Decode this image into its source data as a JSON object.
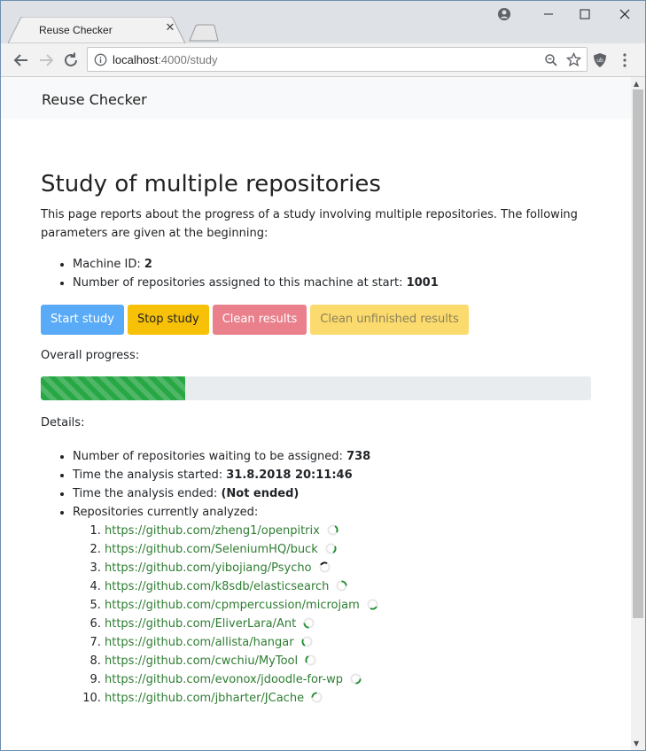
{
  "browser": {
    "tab_title": "Reuse Checker",
    "url_host": "localhost",
    "url_path": ":4000/study"
  },
  "navbar": {
    "brand": "Reuse Checker"
  },
  "page": {
    "title": "Study of multiple repositories",
    "intro": "This page reports about the progress of a study involving multiple repositories. The following parameters are given at the beginning:",
    "params": [
      {
        "label": "Machine ID: ",
        "value": "2"
      },
      {
        "label": "Number of repositories assigned to this machine at start: ",
        "value": "1001"
      }
    ],
    "buttons": {
      "start": "Start study",
      "stop": "Stop study",
      "clean": "Clean results",
      "clean_unfinished": "Clean unfinished results"
    },
    "progress_label": "Overall progress:",
    "progress_fraction": 0.262,
    "details_label": "Details:",
    "details": [
      {
        "label": "Number of repositories waiting to be assigned: ",
        "value": "738"
      },
      {
        "label": "Time the analysis started: ",
        "value": "31.8.2018 20:11:46"
      },
      {
        "label": "Time the analysis ended: ",
        "value": "(Not ended)"
      },
      {
        "label": "Repositories currently analyzed:",
        "value": ""
      }
    ],
    "repos": [
      "https://github.com/zheng1/openpitrix",
      "https://github.com/SeleniumHQ/buck",
      "https://github.com/yibojiang/Psycho",
      "https://github.com/k8sdb/elasticsearch",
      "https://github.com/cpmpercussion/microjam",
      "https://github.com/EliverLara/Ant",
      "https://github.com/allista/hangar",
      "https://github.com/cwchiu/MyTool",
      "https://github.com/evonox/jdoodle-for-wp",
      "https://github.com/jbharter/JCache"
    ]
  },
  "colors": {
    "primary": "#5aabf7",
    "warning": "#f7c108",
    "danger": "#e9808c",
    "success": "#28a745",
    "link": "#2e7d32"
  }
}
